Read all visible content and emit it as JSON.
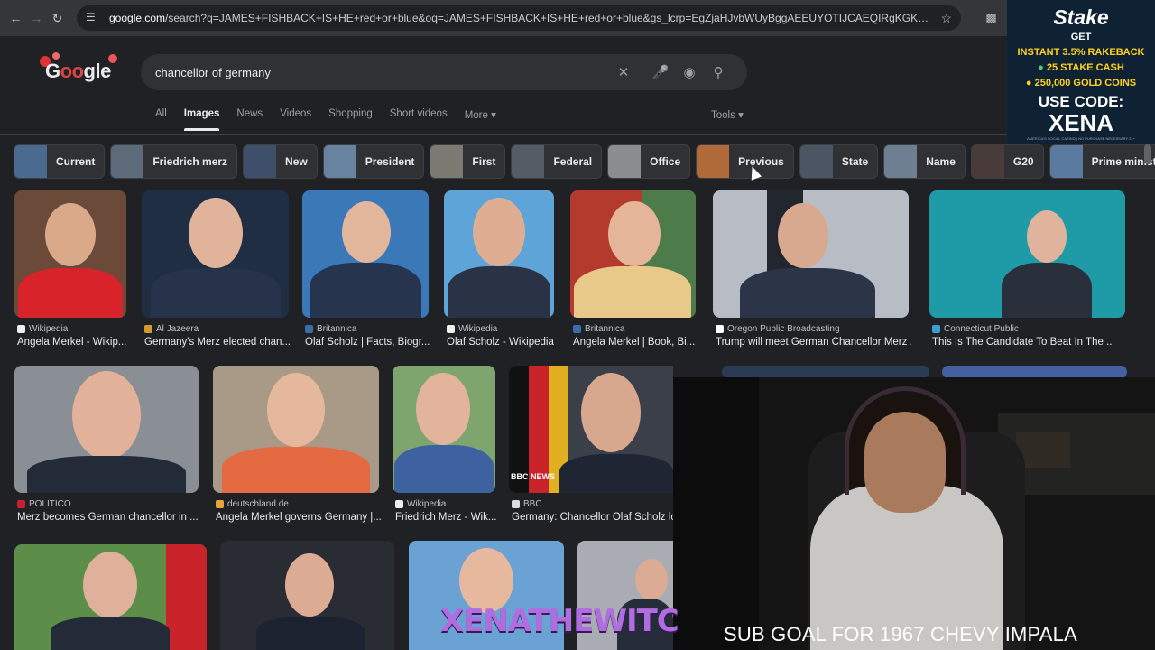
{
  "browser": {
    "url_host": "google.com",
    "url_rest": "/search?q=JAMES+FISHBACK+IS+HE+red+or+blue&oq=JAMES+FISHBACK+IS+HE+red+or+blue&gs_lcrp=EgZjaHJvbWUyBggAEEUYOTIJCAEQIRgKGKABMgkIAhAhGAoYoAEy..."
  },
  "search": {
    "query": "chancellor of germany"
  },
  "tabs": [
    "All",
    "Images",
    "News",
    "Videos",
    "Shopping",
    "Short videos",
    "More"
  ],
  "tools_label": "Tools",
  "chips": [
    "Current",
    "Friedrich merz",
    "New",
    "President",
    "First",
    "Federal",
    "Office",
    "Previous",
    "State",
    "Name",
    "G20",
    "Prime minister"
  ],
  "results": [
    {
      "source": "Wikipedia",
      "title": "Angela Merkel - Wikip..."
    },
    {
      "source": "Al Jazeera",
      "title": "Germany's Merz elected chan..."
    },
    {
      "source": "Britannica",
      "title": "Olaf Scholz | Facts, Biogr..."
    },
    {
      "source": "Wikipedia",
      "title": "Olaf Scholz - Wikipedia"
    },
    {
      "source": "Britannica",
      "title": "Angela Merkel | Book, Bi..."
    },
    {
      "source": "Oregon Public Broadcasting",
      "title": "Trump will meet German Chancellor Merz ..."
    },
    {
      "source": "Connecticut Public",
      "title": "This Is The Candidate To Beat In The ..."
    },
    {
      "source": "POLITICO",
      "title": "Merz becomes German chancellor in ..."
    },
    {
      "source": "deutschland.de",
      "title": "Angela Merkel governs Germany |..."
    },
    {
      "source": "Wikipedia",
      "title": "Friedrich Merz - Wik..."
    },
    {
      "source": "BBC",
      "title": "Germany: Chancellor Olaf Scholz los..."
    }
  ],
  "bbc_badge": "BBC NEWS",
  "ad": {
    "brand": "Stake",
    "line1": "GET",
    "line2": "INSTANT 3.5% RAKEBACK",
    "line3": "25 STAKE CASH",
    "line4": "250,000 GOLD COINS",
    "line5": "USE CODE:",
    "code": "XENA",
    "fine": "AMERICA'S SOCIAL CASINO | NO PURCHASE NECESSARY 21+"
  },
  "overlay": {
    "watermark": "XENATHEWITCH",
    "subgoal": "SUB GOAL FOR 1967 CHEVY IMPALA"
  },
  "colors": {
    "page_bg": "#202124",
    "chip_bg": "#303134",
    "ad_accent": "#ffd21f",
    "watermark": "#b06de0"
  }
}
